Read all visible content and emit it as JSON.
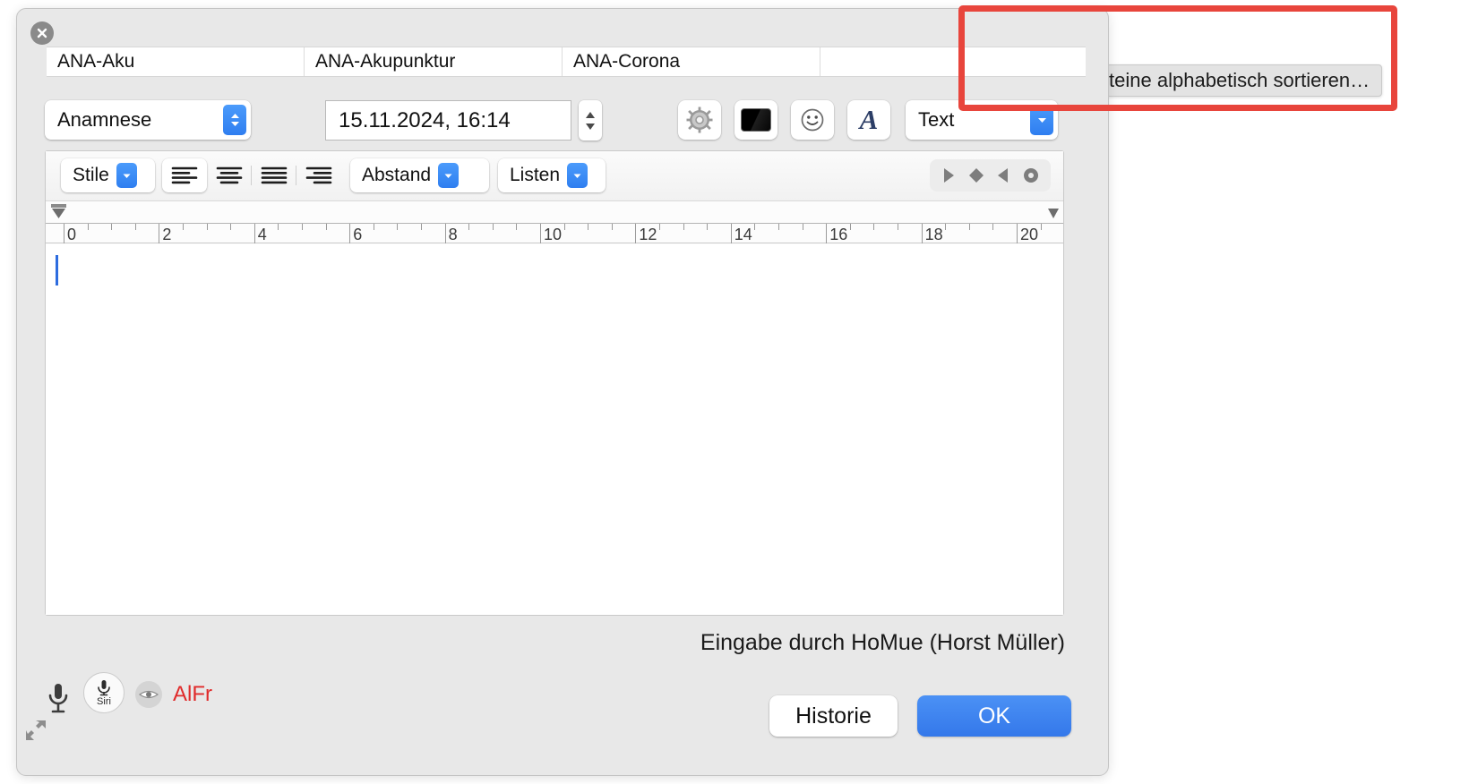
{
  "window": {
    "close_label": "×",
    "tabs": [
      {
        "label": "ANA-Aku"
      },
      {
        "label": "ANA-Akupunktur"
      },
      {
        "label": "ANA-Corona"
      },
      {
        "label": ""
      }
    ],
    "controls": {
      "kind_value": "Anamnese",
      "date_value": "15.11.2024, 16:14",
      "gear_icon": "gear-icon",
      "color_swatch_value": "#000000",
      "emoji_icon": "smiley-icon",
      "font_icon": "italic-a-icon",
      "text_popup_value": "Text"
    },
    "format_bar": {
      "styles_label": "Stile",
      "align_buttons": [
        {
          "name": "align-left",
          "selected": true
        },
        {
          "name": "align-center",
          "selected": false
        },
        {
          "name": "align-justify",
          "selected": false
        },
        {
          "name": "align-right",
          "selected": false
        }
      ],
      "spacing_label": "Abstand",
      "lists_label": "Listen",
      "nav_buttons": [
        {
          "name": "play-triangle-right-icon"
        },
        {
          "name": "diamond-icon"
        },
        {
          "name": "play-triangle-left-icon"
        },
        {
          "name": "record-circle-icon"
        }
      ]
    },
    "ruler": {
      "labels": [
        "0",
        "2",
        "4",
        "6",
        "8",
        "10",
        "12",
        "14",
        "16",
        "18",
        "20"
      ],
      "unit_max": 21
    },
    "editor": {
      "content": "",
      "caret_visible": true
    },
    "footer_note": "Eingabe durch HoMue (Horst Müller)",
    "bottom_bar": {
      "mic_icon": "microphone-icon",
      "siri_label": "Siri",
      "eye_icon": "eye-icon",
      "user_initials": "AlFr",
      "resize_icon": "resize-handle-icon",
      "history_button": "Historie",
      "ok_button": "OK"
    }
  },
  "background_app": {
    "toolbar": [
      {
        "name": "sort-lines-icon",
        "active": true
      },
      {
        "name": "more-options-icon",
        "active": false
      }
    ],
    "tooltip": "Textbausteine alphabetisch sortieren…"
  },
  "annotation": {
    "highlight_color": "#e8453c"
  }
}
